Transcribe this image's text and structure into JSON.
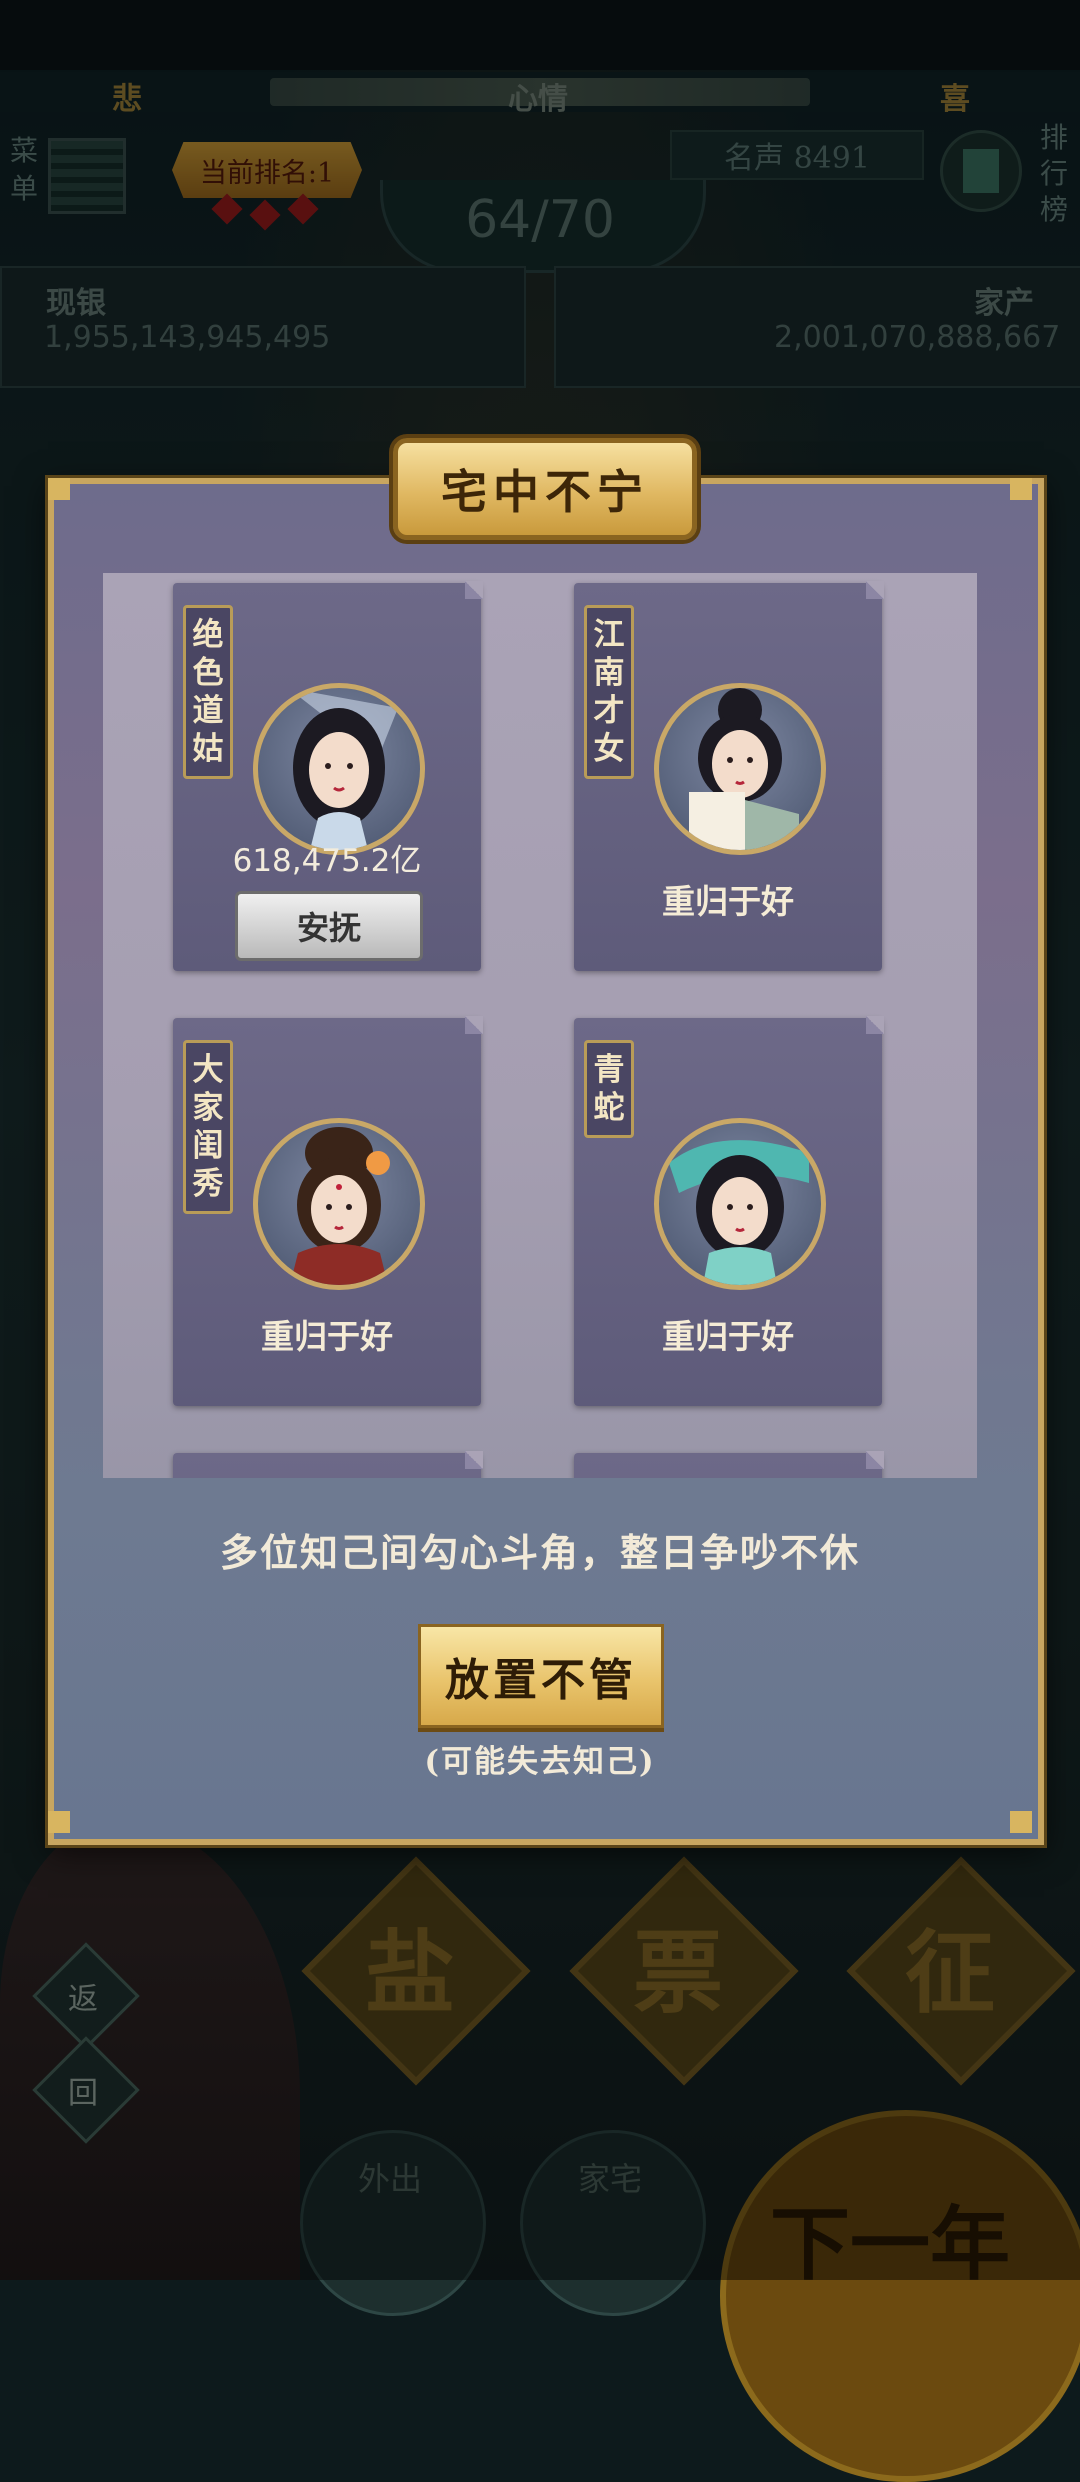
{
  "hud": {
    "mood_left": "悲",
    "mood_center": "心情",
    "mood_right": "喜",
    "menu_label": "菜单",
    "rank_label": "当前排名:1",
    "fame_label": "名声 8491",
    "rank_board_label": "排行榜",
    "progress": "64/70",
    "cash_title": "现银",
    "cash_value": "1,955,143,945,495",
    "assets_title": "家产",
    "assets_value": "2,001,070,888,667"
  },
  "bottom": {
    "actions": [
      "盐",
      "票",
      "征"
    ],
    "side_return": "返",
    "side_back": "回",
    "nav_outing": "外出",
    "nav_home": "家宅",
    "next_year": "下一年"
  },
  "dialog": {
    "title": "宅中不宁",
    "cards": [
      {
        "name": "绝色道姑",
        "value": "618,475.2亿",
        "button": "安抚"
      },
      {
        "name": "江南才女",
        "status": "重归于好"
      },
      {
        "name": "大家闺秀",
        "status": "重归于好"
      },
      {
        "name": "青蛇",
        "status": "重归于好"
      }
    ],
    "message": "多位知己间勾心斗角，整日争吵不休",
    "ignore_button": "放置不管",
    "warning": "(可能失去知己)"
  },
  "colors": {
    "dialog_border": "#c8a660",
    "plaque_gold": "#e0b862",
    "card_bg": "#5e5b7a"
  }
}
